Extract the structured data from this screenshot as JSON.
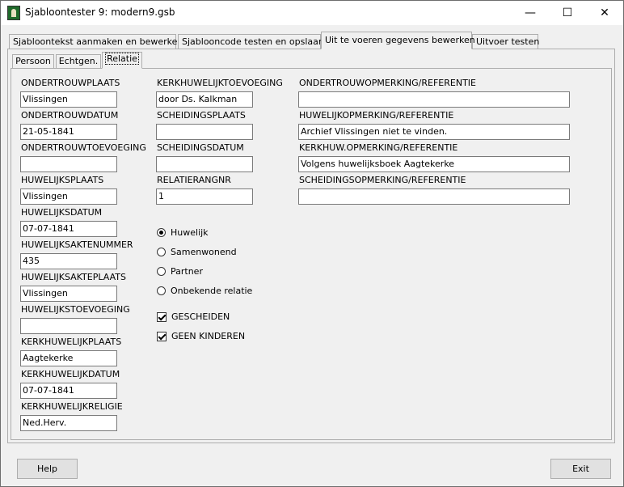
{
  "window": {
    "title": "Sjabloontester 9: modern9.gsb",
    "minimize": "—",
    "maximize": "☐",
    "close": "✕"
  },
  "outer_tabs": [
    "Sjabloontekst aanmaken en bewerken",
    "Sjablooncode testen en opslaan",
    "Uit te voeren gegevens bewerken",
    "Uitvoer testen"
  ],
  "inner_tabs": [
    "Persoon",
    "Echtgen.",
    "Relatie"
  ],
  "col1": [
    {
      "label": "ONDERTROUWPLAATS",
      "value": "Vlissingen"
    },
    {
      "label": "ONDERTROUWDATUM",
      "value": "21-05-1841"
    },
    {
      "label": "ONDERTROUWTOEVOEGING",
      "value": ""
    },
    {
      "label": "HUWELIJKSPLAATS",
      "value": "Vlissingen"
    },
    {
      "label": "HUWELIJKSDATUM",
      "value": "07-07-1841"
    },
    {
      "label": "HUWELIJKSAKTENUMMER",
      "value": "435"
    },
    {
      "label": "HUWELIJKSAKTEPLAATS",
      "value": "Vlissingen"
    },
    {
      "label": "HUWELIJKSTOEVOEGING",
      "value": ""
    },
    {
      "label": "KERKHUWELIJKPLAATS",
      "value": "Aagtekerke"
    },
    {
      "label": "KERKHUWELIJKDATUM",
      "value": "07-07-1841"
    },
    {
      "label": "KERKHUWELIJKRELIGIE",
      "value": "Ned.Herv."
    }
  ],
  "col2": [
    {
      "label": "KERKHUWELIJKTOEVOEGING",
      "value": "door Ds. Kalkman"
    },
    {
      "label": "SCHEIDINGSPLAATS",
      "value": ""
    },
    {
      "label": "SCHEIDINGSDATUM",
      "value": ""
    },
    {
      "label": "RELATIERANGNR",
      "value": "1"
    }
  ],
  "col3": [
    {
      "label": "ONDERTROUWOPMERKING/REFERENTIE",
      "value": ""
    },
    {
      "label": "HUWELIJKOPMERKING/REFERENTIE",
      "value": "Archief Vlissingen niet te vinden."
    },
    {
      "label": "KERKHUW.OPMERKING/REFERENTIE",
      "value": "Volgens huwelijksboek Aagtekerke"
    },
    {
      "label": "SCHEIDINGSOPMERKING/REFERENTIE",
      "value": ""
    }
  ],
  "radios": [
    {
      "label": "Huwelijk",
      "selected": true
    },
    {
      "label": "Samenwonend",
      "selected": false
    },
    {
      "label": "Partner",
      "selected": false
    },
    {
      "label": "Onbekende relatie",
      "selected": false
    }
  ],
  "checkboxes": [
    {
      "label": "GESCHEIDEN",
      "checked": true
    },
    {
      "label": "GEEN KINDEREN",
      "checked": true
    }
  ],
  "buttons": {
    "help": "Help",
    "exit": "Exit"
  }
}
